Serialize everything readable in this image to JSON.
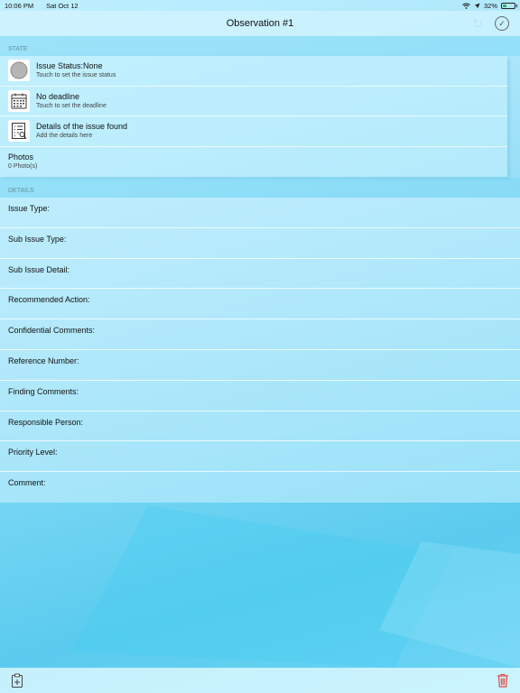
{
  "status_bar": {
    "time": "10:06 PM",
    "date": "Sat Oct 12",
    "battery": "32%",
    "battery_level": 0.32
  },
  "nav": {
    "title": "Observation #1"
  },
  "state_section": {
    "header": "STATE",
    "rows": [
      {
        "title": "Issue Status:None",
        "subtitle": "Touch to set the issue status",
        "icon": "status-circle-icon"
      },
      {
        "title": "No deadline",
        "subtitle": "Touch to set the deadline",
        "icon": "calendar-icon"
      },
      {
        "title": "Details of the issue found",
        "subtitle": "Add the details here",
        "icon": "details-list-icon"
      },
      {
        "title": "Photos",
        "subtitle": "0 Photo(s)"
      }
    ]
  },
  "details_section": {
    "header": "DETAILS",
    "fields": [
      "Issue Type:",
      "Sub Issue Type:",
      "Sub Issue Detail:",
      "Recommended Action:",
      "Confidential Comments:",
      "Reference Number:",
      "Finding Comments:",
      "Responsible Person:",
      "Priority Level:",
      "Comment:"
    ]
  },
  "colors": {
    "delete": "#e8453c",
    "accent": "#5acbee"
  }
}
